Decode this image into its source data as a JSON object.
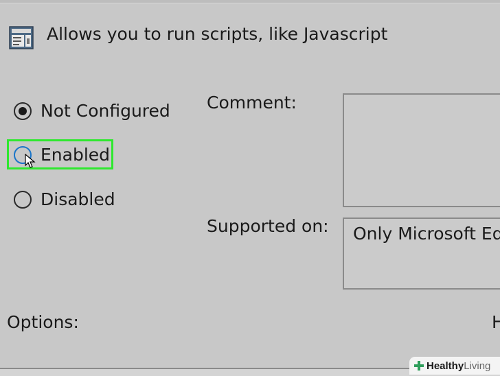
{
  "window": {
    "title": "Allows you to run scripts, like Javascript",
    "icon": "policy-setting-icon"
  },
  "state": {
    "options": [
      {
        "label": "Not Configured",
        "selected": true
      },
      {
        "label": "Enabled",
        "selected": false,
        "highlighted": true
      },
      {
        "label": "Disabled",
        "selected": false
      }
    ]
  },
  "fields": {
    "comment_label": "Comment:",
    "comment_value": "",
    "supported_label": "Supported on:",
    "supported_value": "Only Microsoft Ed"
  },
  "sections": {
    "options_label": "Options:",
    "help_label": "H"
  },
  "watermark": {
    "brand": "Healthy",
    "suffix": "Living"
  },
  "colors": {
    "highlight": "#2ee82e",
    "background": "#c8c8c8"
  }
}
